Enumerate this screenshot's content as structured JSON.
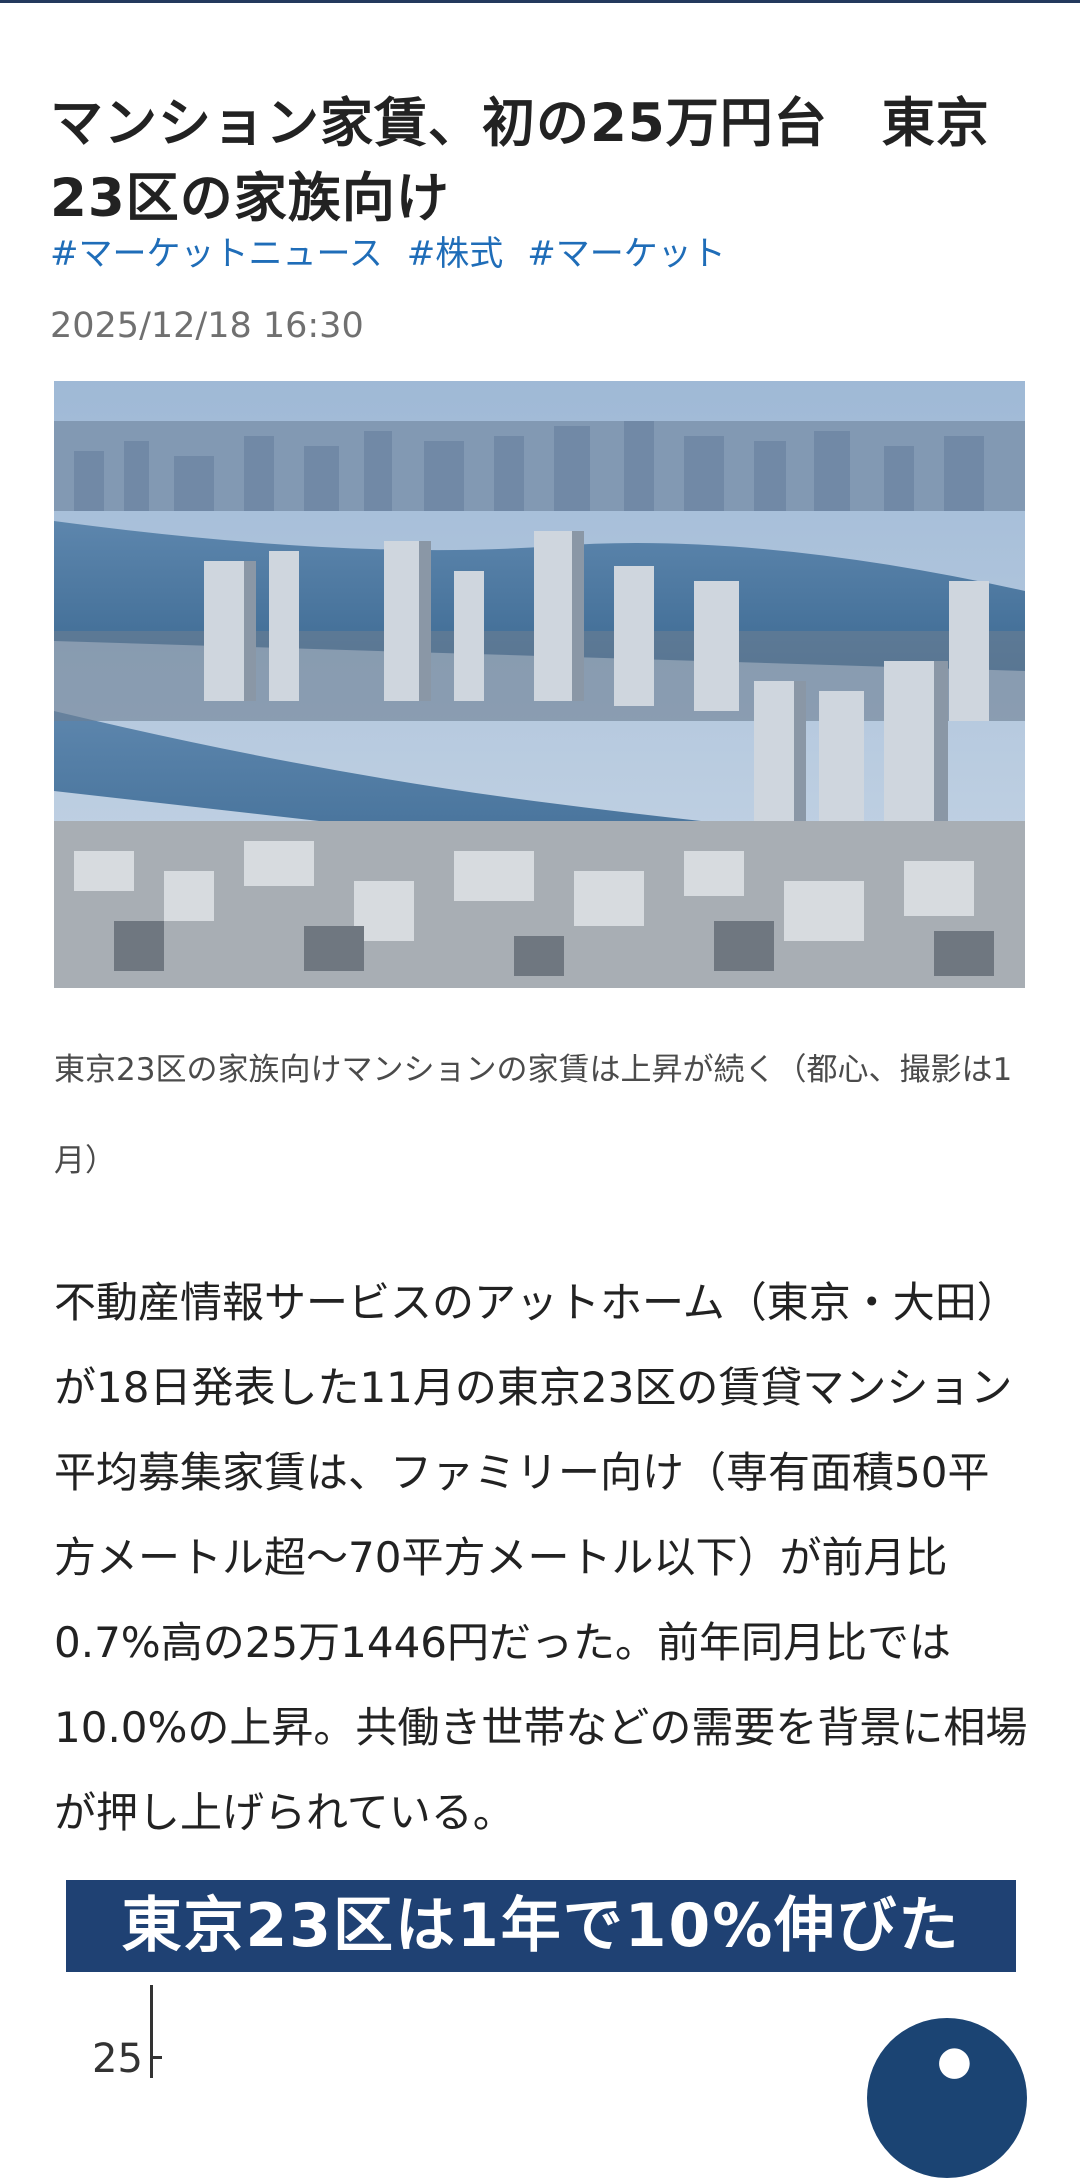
{
  "article": {
    "title": "マンション家賃、初の25万円台　東京23区の家族向け",
    "tags": [
      "#マーケットニュース",
      "#株式",
      "#マーケット"
    ],
    "date": "2025/12/18 16:30",
    "caption": "東京23区の家族向けマンションの家賃は上昇が続く（都心、撮影は1月）",
    "body": "不動産情報サービスのアットホーム（東京・大田）が18日発表した11月の東京23区の賃貸マンション平均募集家賃は、ファミリー向け（専有面積50平方メートル超〜70平方メートル以下）が前月比0.7%高の25万1446円だった。前年同月比では10.0%の上昇。共働き世帯などの需要を背景に相場が押し上げられている。"
  },
  "infographic": {
    "title": "東京23区は1年で10%伸びた",
    "axis_label": "25"
  },
  "colors": {
    "tag": "#1f6db8",
    "infographic_bg": "#1f4173",
    "fab_bg": "#1b4473"
  }
}
